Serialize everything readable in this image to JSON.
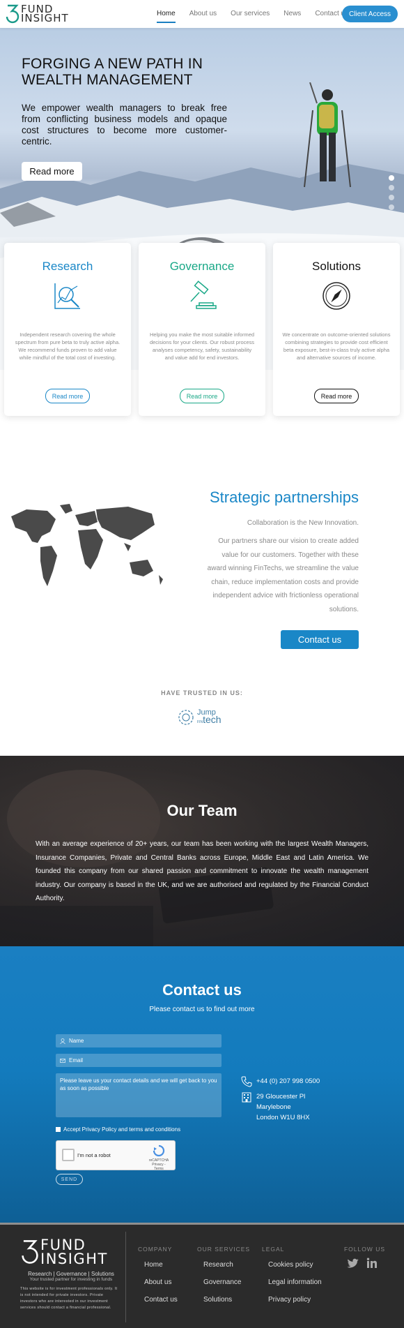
{
  "header": {
    "logo_line1": "FUND",
    "logo_line2": "INSIGHT",
    "nav": [
      {
        "label": "Home",
        "active": true
      },
      {
        "label": "About us"
      },
      {
        "label": "Our services"
      },
      {
        "label": "News"
      },
      {
        "label": "Contact us"
      }
    ],
    "client_access": "Client Access"
  },
  "hero": {
    "title": "FORGING A NEW PATH IN WEALTH MANAGEMENT",
    "lead": "We empower wealth managers to break free from conflicting business models and opaque cost structures to become more customer-centric.",
    "button": "Read more",
    "slides_total": 4,
    "slide_active": 1
  },
  "cards": [
    {
      "title": "Research",
      "icon": "research-magnifier-chart-icon",
      "color": "#1a87c7",
      "text": "Independent research covering the whole spectrum from pure beta to truly active alpha. We recommend funds proven to add value while mindful of the total cost of investing.",
      "button": "Read more"
    },
    {
      "title": "Governance",
      "icon": "gavel-icon",
      "color": "#19a887",
      "text": "Helping you make the most suitable informed decisions for your clients. Our robust process analyses competency, safety, sustainability and value add for end investors.",
      "button": "Read more"
    },
    {
      "title": "Solutions",
      "icon": "compass-icon",
      "color": "#111111",
      "text": "We concentrate on outcome-oriented solutions combining strategies to provide cost efficient beta exposure, best-in-class truly active alpha and alternative sources of income.",
      "button": "Read more"
    }
  ],
  "partnerships": {
    "title": "Strategic partnerships",
    "tagline": "Collaboration is the New Innovation.",
    "description": "Our partners share our vision to create added value for our customers. Together with these award winning FinTechs, we streamline the value chain, reduce implementation costs and provide independent advice with frictionless operational solutions.",
    "button": "Contact us",
    "trusted_label": "HAVE TRUSTED IN US:",
    "partner_logo_word1": "Jump",
    "partner_logo_small": "FIN",
    "partner_logo_word2": "tech"
  },
  "team": {
    "title": "Our Team",
    "text": "With an average experience of 20+ years, our team has been working with the largest Wealth Managers, Insurance Companies, Private and  Central Banks across Europe, Middle East and Latin America. We founded this company from our shared passion and commitment to innovate the wealth management industry. Our company is based in the UK, and we are authorised and regulated by the Financial Conduct Authority."
  },
  "contact": {
    "title": "Contact us",
    "subtitle": "Please contact us to find out more",
    "name_placeholder": "Name",
    "email_placeholder": "Email",
    "message_placeholder": "Please leave us your contact details and we will get back to you as soon as possible",
    "accept_label": "Accept Privacy Policy and terms and conditions",
    "recaptcha_label": "I'm not a robot",
    "recaptcha_brand": "reCAPTCHA",
    "recaptcha_links": "Privacy - Terms",
    "send": "SEND",
    "phone": "+44 (0) 207 998 0500",
    "address_line1": "29 Gloucester Pl",
    "address_line2": "Marylebone",
    "address_line3": "London W1U 8HX"
  },
  "footer": {
    "logo_line1": "FUND",
    "logo_line2": "INSIGHT",
    "tagline": "Research | Governance | Solutions",
    "tagline2": "Your trusted partner for investing in funds",
    "disclaimer": "This website is for investment professionals only. It is not intended for private investors. Private investors who are interested in our investment services should contact a financial professional.",
    "columns": [
      {
        "heading": "COMPANY",
        "links": [
          "Home",
          "About us",
          "Contact us"
        ]
      },
      {
        "heading": "OUR SERVICES",
        "links": [
          "Research",
          "Governance",
          "Solutions"
        ]
      },
      {
        "heading": "LEGAL",
        "links": [
          "Cookies policy",
          "Legal information",
          "Privacy policy"
        ]
      }
    ],
    "follow": "FOLLOW US"
  }
}
